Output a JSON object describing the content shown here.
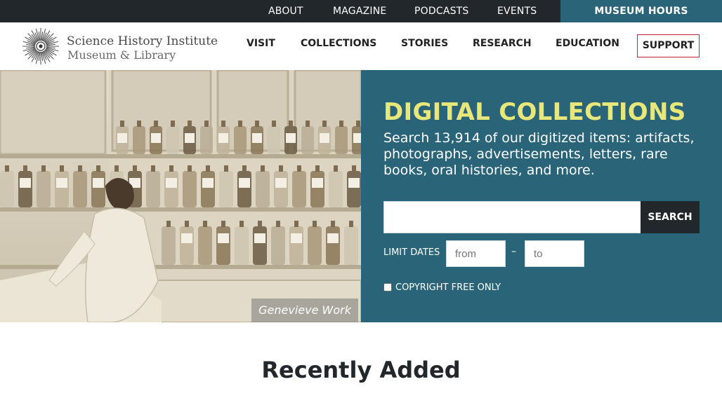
{
  "utility_nav": {
    "items": [
      "ABOUT",
      "MAGAZINE",
      "PODCASTS",
      "EVENTS"
    ],
    "museum_hours": "MUSEUM HOURS"
  },
  "logo": {
    "line1": "Science History Institute",
    "line2": "Museum & Library"
  },
  "main_nav": {
    "items": [
      "VISIT",
      "COLLECTIONS",
      "STORIES",
      "RESEARCH",
      "EDUCATION"
    ],
    "support": "SUPPORT"
  },
  "hero": {
    "caption": "Genevieve Work",
    "title": "DIGITAL COLLECTIONS",
    "description": "Search 13,914 of our digitized items: artifacts, photographs, advertisements, letters, rare books, oral histories, and more.",
    "search_value": "",
    "search_button": "SEARCH",
    "limit_dates_label": "LIMIT DATES",
    "from_placeholder": "from",
    "date_separator": "–",
    "to_placeholder": "to",
    "copyright_label": "COPYRIGHT FREE ONLY",
    "copyright_checked": false
  },
  "recently_added": {
    "title": "Recently Added"
  },
  "colors": {
    "topbar": "#22272b",
    "teal": "#2a6478",
    "accent_yellow": "#e8e77a",
    "support_border": "#c0243c"
  }
}
